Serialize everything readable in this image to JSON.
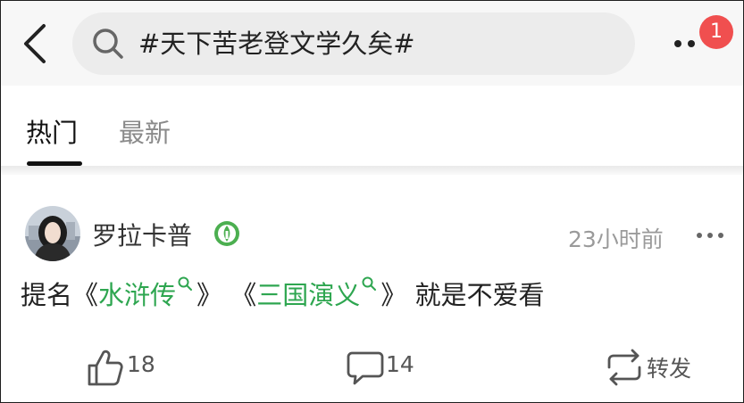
{
  "header": {
    "search_query": "#天下苦老登文学久矣#",
    "notification_count": "1"
  },
  "tabs": [
    {
      "label": "热门",
      "active": true
    },
    {
      "label": "最新",
      "active": false
    }
  ],
  "post": {
    "author": "罗拉卡普",
    "time": "23小时前",
    "content": {
      "prefix": "提名",
      "open1": "《",
      "topic1": "水浒传",
      "close1": "》",
      "open2": "《",
      "topic2": "三国演义",
      "close2": "》",
      "suffix": "就是不爱看"
    },
    "actions": {
      "likes": "18",
      "comments": "14",
      "repost_label": "转发"
    }
  },
  "colors": {
    "link_green": "#2ea650",
    "badge_red": "#f04f4f",
    "verified_green": "#4caf50"
  },
  "icons": {
    "back": "chevron-left-icon",
    "search": "search-icon",
    "more": "more-dots-icon",
    "verified": "verified-badge-icon",
    "like": "thumb-up-icon",
    "comment": "comment-bubble-icon",
    "repost": "repost-icon"
  }
}
